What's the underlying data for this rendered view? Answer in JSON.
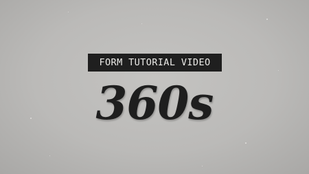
{
  "label": {
    "text": "FORM TUTORIAL VIDEO"
  },
  "title": {
    "text": "360s"
  },
  "colors": {
    "background": "#b8b7b5",
    "label_background": "#1f1f1f",
    "label_text": "#ecebe8",
    "title_text": "#1e1e1e"
  }
}
